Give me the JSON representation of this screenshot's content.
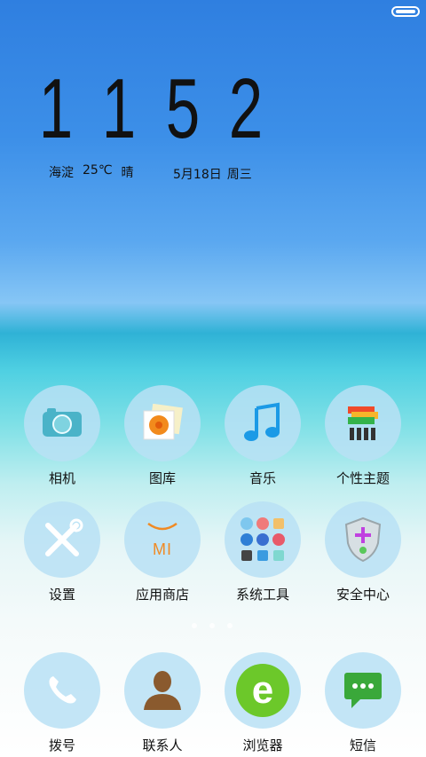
{
  "clock": {
    "digits": [
      "1",
      "1",
      "5",
      "2"
    ]
  },
  "weather": {
    "city": "海淀",
    "temp": "25℃",
    "condition": "晴"
  },
  "date": {
    "date": "5月18日",
    "weekday": "周三"
  },
  "apps_row1": [
    {
      "label": "相机",
      "icon": "camera-icon"
    },
    {
      "label": "图库",
      "icon": "gallery-icon"
    },
    {
      "label": "音乐",
      "icon": "music-note-icon"
    },
    {
      "label": "个性主题",
      "icon": "theme-icon"
    }
  ],
  "apps_row2": [
    {
      "label": "设置",
      "icon": "settings-tools-icon"
    },
    {
      "label": "应用商店",
      "icon": "mi-store-icon",
      "icon_text": "MI"
    },
    {
      "label": "系统工具",
      "icon": "system-tools-folder-icon"
    },
    {
      "label": "安全中心",
      "icon": "security-shield-icon"
    }
  ],
  "dock": [
    {
      "label": "拨号",
      "icon": "phone-icon"
    },
    {
      "label": "联系人",
      "icon": "contacts-icon"
    },
    {
      "label": "浏览器",
      "icon": "browser-icon",
      "icon_text": "e"
    },
    {
      "label": "短信",
      "icon": "messages-icon"
    }
  ],
  "colors": {
    "icon_circle": "#b9e1f5",
    "text": "#111111",
    "mi_orange": "#f08a24"
  }
}
